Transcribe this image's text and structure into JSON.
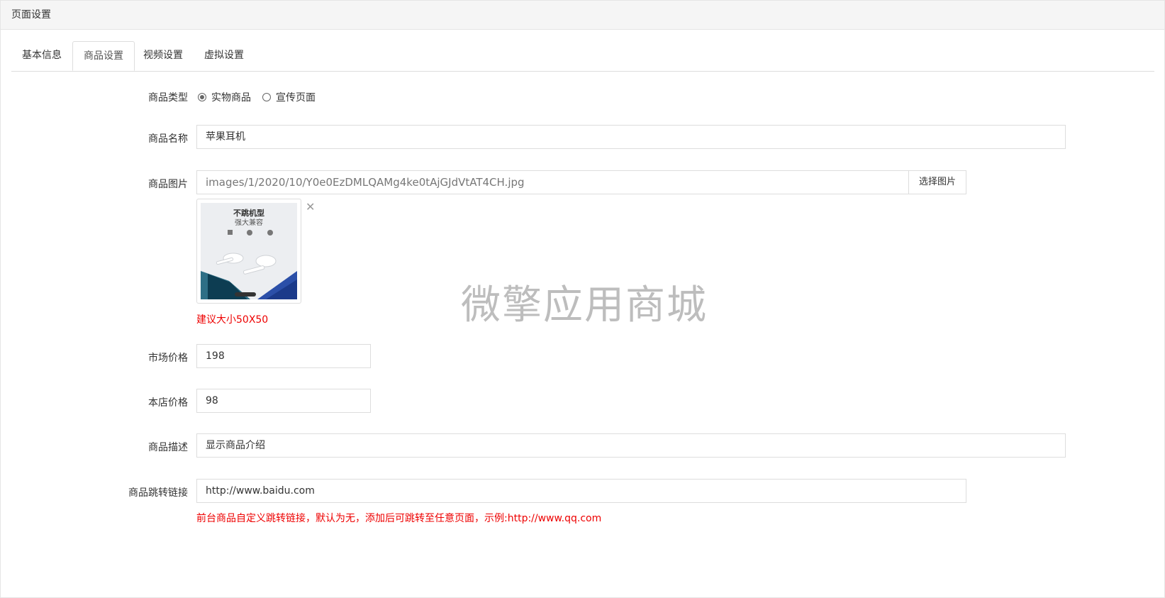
{
  "panel": {
    "title": "页面设置"
  },
  "tabs": [
    {
      "label": "基本信息"
    },
    {
      "label": "商品设置"
    },
    {
      "label": "视频设置"
    },
    {
      "label": "虚拟设置"
    }
  ],
  "form": {
    "type": {
      "label": "商品类型",
      "options": [
        {
          "label": "实物商品",
          "checked": true
        },
        {
          "label": "宣传页面",
          "checked": false
        }
      ]
    },
    "name": {
      "label": "商品名称",
      "value": "苹果耳机"
    },
    "image": {
      "label": "商品图片",
      "value": "images/1/2020/10/Y0e0EzDMLQAMg4ke0tAjGJdVtAT4CH.jpg",
      "button": "选择图片",
      "close_glyph": "✕",
      "hint": "建议大小50X50",
      "thumb_text_1": "不跳机型",
      "thumb_text_2": "强大兼容"
    },
    "market_price": {
      "label": "市场价格",
      "value": "198"
    },
    "shop_price": {
      "label": "本店价格",
      "value": "98"
    },
    "description": {
      "label": "商品描述",
      "value": "显示商品介绍"
    },
    "link": {
      "label": "商品跳转链接",
      "value": "http://www.baidu.com",
      "hint": "前台商品自定义跳转链接，默认为无，添加后可跳转至任意页面，示例:http://www.qq.com"
    }
  },
  "watermark": "微擎应用商城"
}
